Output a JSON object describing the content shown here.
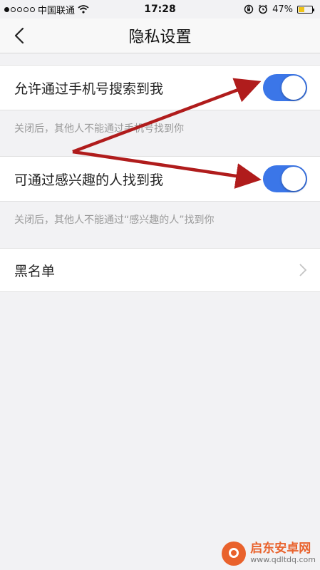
{
  "status_bar": {
    "carrier": "中国联通",
    "time": "17:28",
    "battery_percent": "47%",
    "signal_bars_filled": 1,
    "signal_bars_total": 5,
    "battery_level": 0.47,
    "icons": [
      "wifi-icon",
      "rotation-lock-icon",
      "alarm-icon",
      "battery-icon"
    ]
  },
  "nav": {
    "title": "隐私设置",
    "back_icon": "chevron-left-icon"
  },
  "settings": [
    {
      "label": "允许通过手机号搜索到我",
      "hint": "关闭后，其他人不能通过手机号找到你",
      "toggle_on": true
    },
    {
      "label": "可通过感兴趣的人找到我",
      "hint": "关闭后，其他人不能通过“感兴趣的人”找到你",
      "toggle_on": true
    }
  ],
  "blacklist": {
    "label": "黑名单",
    "icon": "chevron-right-icon"
  },
  "watermark": {
    "title": "启东安卓网",
    "url": "www.qdltdq.com"
  },
  "colors": {
    "toggle_on": "#3b76e8",
    "annotation_arrow": "#b01c1c",
    "background": "#f2f2f4",
    "hint_text": "#9a9a9a"
  }
}
